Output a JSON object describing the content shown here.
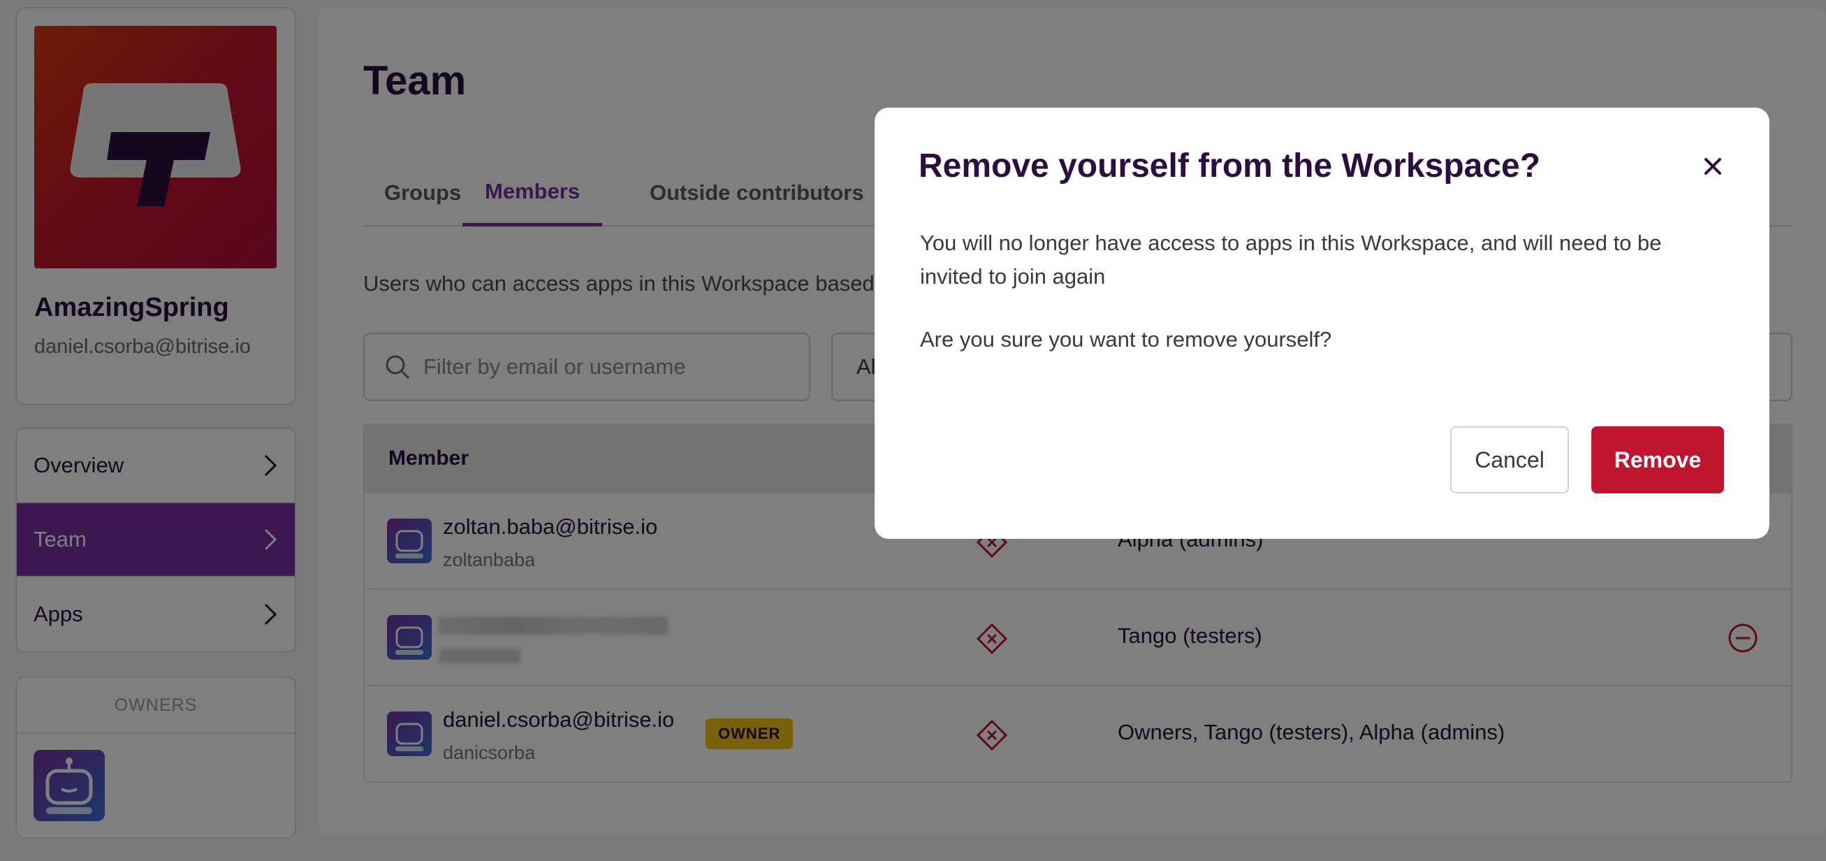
{
  "workspace": {
    "name": "AmazingSpring",
    "email": "daniel.csorba@bitrise.io",
    "brand_gradient": [
      "#d93a12",
      "#b00a38"
    ]
  },
  "nav": {
    "items": [
      {
        "label": "Overview",
        "active": false
      },
      {
        "label": "Team",
        "active": true
      },
      {
        "label": "Apps",
        "active": false
      }
    ]
  },
  "owners": {
    "heading": "OWNERS"
  },
  "page": {
    "title": "Team",
    "tabs": [
      {
        "label": "Groups",
        "active": false
      },
      {
        "label": "Members",
        "active": true
      },
      {
        "label": "Outside contributors",
        "active": false
      }
    ],
    "description": "Users who can access apps in this Workspace based",
    "search": {
      "placeholder": "Filter by email or username"
    },
    "filter": {
      "value": "Al"
    }
  },
  "table": {
    "column_member": "Member",
    "rows": [
      {
        "email": "zoltan.baba@bitrise.io",
        "username": "zoltanbaba",
        "owner": false,
        "groups": "Alpha (admins)"
      },
      {
        "email": "",
        "username": "",
        "owner": false,
        "blurred": true,
        "groups": "Tango (testers)"
      },
      {
        "email": "daniel.csorba@bitrise.io",
        "username": "danicsorba",
        "owner": true,
        "owner_badge": "OWNER",
        "groups": "Owners, Tango (testers), Alpha (admins)"
      }
    ]
  },
  "modal": {
    "title": "Remove yourself from the Workspace?",
    "body": "You will no longer have access to apps in this Workspace, and will need to be invited to join again",
    "question": "Are you sure you want to remove yourself?",
    "cancel_label": "Cancel",
    "remove_label": "Remove"
  },
  "colors": {
    "accent": "#7b2f9e",
    "danger": "#c0142f",
    "owner_badge": "#f2c318",
    "text_dark": "#2b0e3f"
  },
  "icons": {
    "close": "close-icon",
    "search": "search-icon",
    "chevron": "chevron-right-icon",
    "status": "error-diamond-icon",
    "remove_member": "minus-circle-icon",
    "avatar": "robot-avatar-icon"
  }
}
